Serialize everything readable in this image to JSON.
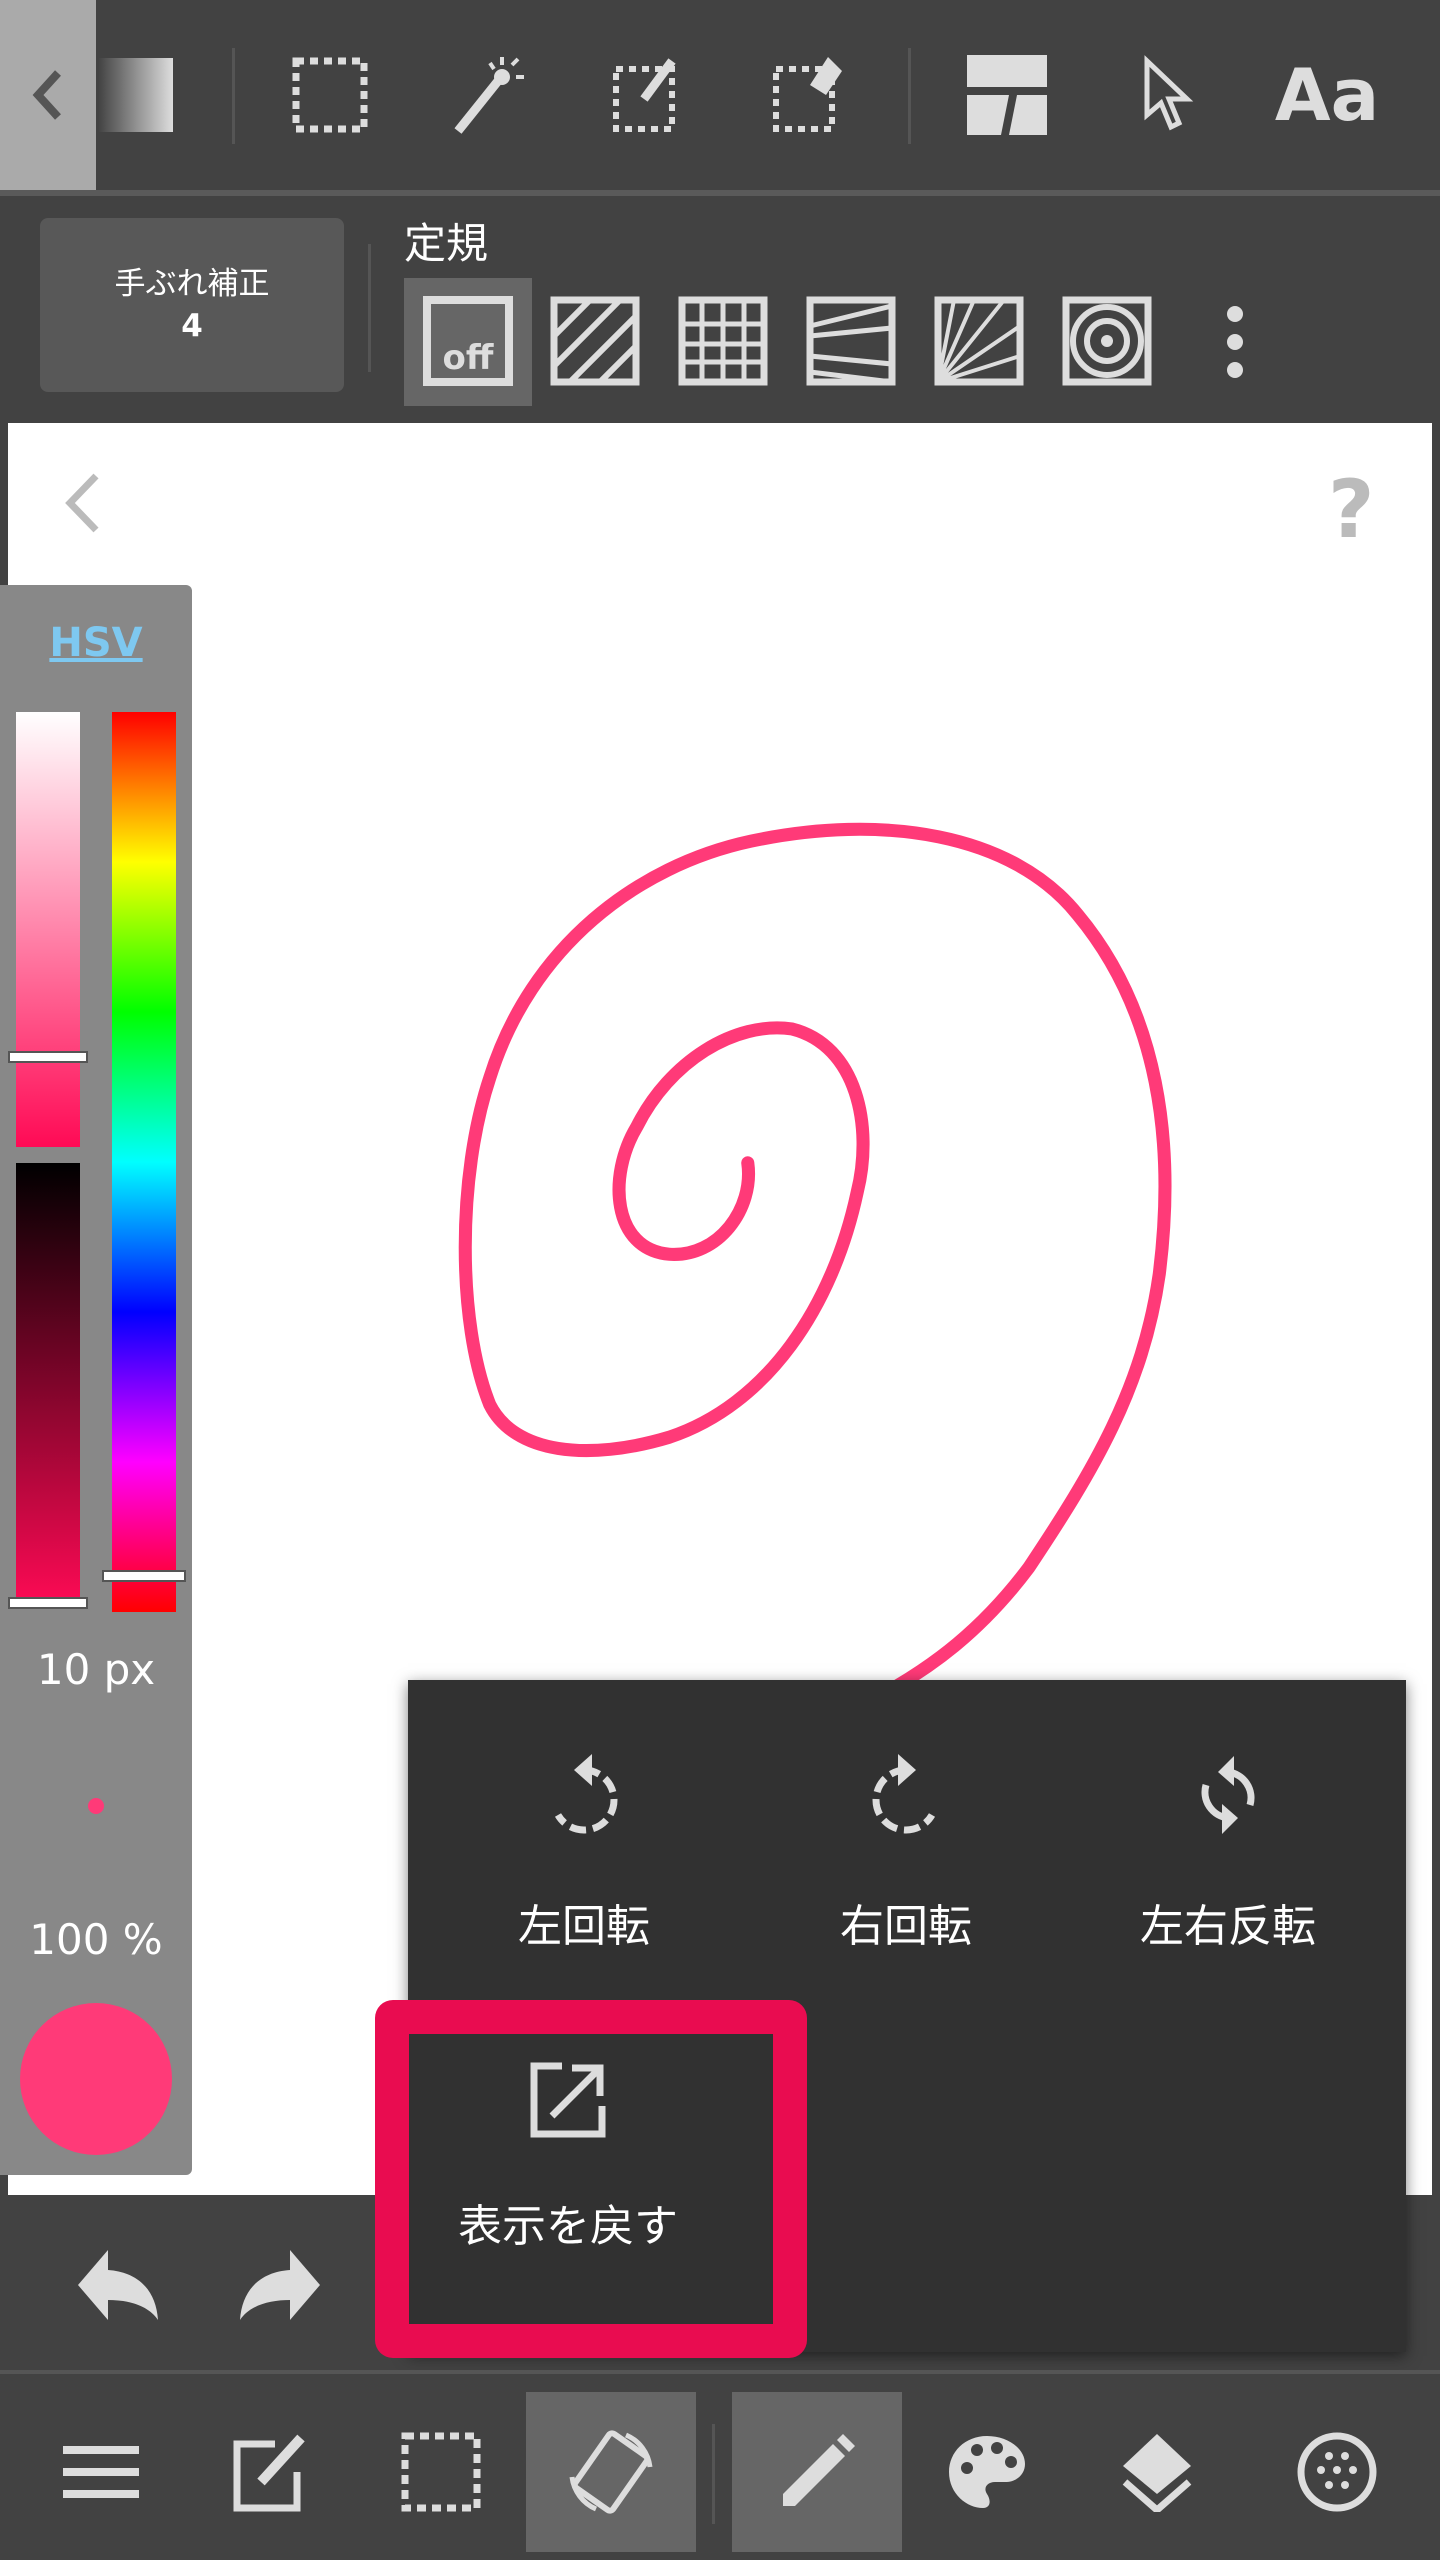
{
  "toolbar": {
    "icons": [
      "back-chevron-icon",
      "gradient-swatch-icon",
      "select-rect-icon",
      "magic-wand-icon",
      "select-pen-icon",
      "select-eraser-icon",
      "panel-frame-icon",
      "pointer-icon",
      "text-icon"
    ],
    "text_label": "Aa"
  },
  "stabilizer": {
    "label": "手ぶれ補正",
    "value": "4"
  },
  "ruler": {
    "title": "定規",
    "off_label": "off",
    "options": [
      "off",
      "parallel",
      "grid",
      "perspective",
      "radial",
      "concentric"
    ]
  },
  "color_panel": {
    "mode": "HSV",
    "brush_size": "10 px",
    "opacity": "100 %",
    "color": "#ff3a78",
    "saturation_level": 0.8,
    "hue_level": 0.96
  },
  "popup": {
    "items": [
      {
        "label": "左回転",
        "icon": "rotate-left-icon"
      },
      {
        "label": "右回転",
        "icon": "rotate-right-icon"
      },
      {
        "label": "左右反転",
        "icon": "flip-horizontal-icon"
      },
      {
        "label": "表示を戻す",
        "icon": "reset-view-icon"
      }
    ]
  },
  "colors": {
    "highlight": "#e90c50",
    "stroke": "#ff3a78"
  }
}
